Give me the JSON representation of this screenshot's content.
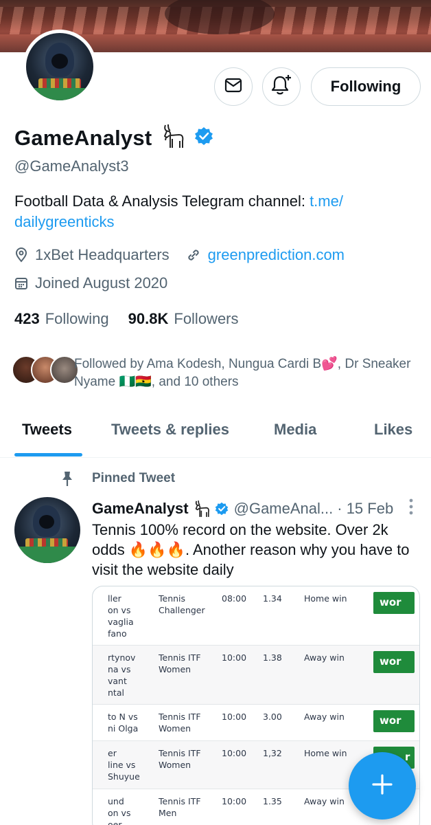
{
  "profile": {
    "name": "GameAnalyst",
    "handle": "@GameAnalyst3",
    "bio_text": "Football Data & Analysis Telegram channel: ",
    "bio_link_1": "t.me/",
    "bio_link_2": "dailygreenticks",
    "location": "1xBet Headquarters",
    "website": "greenprediction.com",
    "joined": "Joined August 2020",
    "following_count": "423",
    "following_label": "Following",
    "followers_count": "90.8K",
    "followers_label": "Followers",
    "follow_button": "Following",
    "followed_by": "Followed by Ama Kodesh, Nungua Cardi B💕, Dr Sneaker Nyame 🇳🇬🇬🇭, and 10 others",
    "verified_color": "#1d9bf0"
  },
  "tabs": [
    {
      "label": "Tweets"
    },
    {
      "label": "Tweets & replies"
    },
    {
      "label": "Media"
    },
    {
      "label": "Likes"
    }
  ],
  "tweet": {
    "pinned_label": "Pinned Tweet",
    "name": "GameAnalyst",
    "handle": "@GameAnal...",
    "date": "· 15 Feb",
    "text": "Tennis 100% record on the website. Over 2k odds 🔥🔥🔥. Another reason why you have to visit the website daily"
  },
  "media_table": {
    "rows": [
      {
        "match": "ller\non vs\nvaglia\nfano",
        "league": "Tennis\nChallenger",
        "time": "08:00",
        "odds": "1.34",
        "tip": "Home win",
        "result": "wor"
      },
      {
        "match": "rtynov\nna vs\nvant\nntal",
        "league": "Tennis ITF\nWomen",
        "time": "10:00",
        "odds": "1.38",
        "tip": "Away win",
        "result": "wor"
      },
      {
        "match": "to N vs\nni Olga",
        "league": "Tennis ITF\nWomen",
        "time": "10:00",
        "odds": "3.00",
        "tip": "Away win",
        "result": "wor"
      },
      {
        "match": "er\nline vs\nShuyue",
        "league": "Tennis ITF\nWomen",
        "time": "10:00",
        "odds": "1,32",
        "tip": "Home win",
        "result": "r"
      },
      {
        "match": "und\non vs\noer",
        "league": "Tennis ITF\nMen",
        "time": "10:00",
        "odds": "1.35",
        "tip": "Away win",
        "result": ""
      }
    ]
  },
  "icons": {
    "message": "envelope-icon",
    "notify": "bell-plus-icon",
    "location": "map-pin-icon",
    "link": "link-icon",
    "calendar": "calendar-icon",
    "pin": "pin-icon",
    "fab": "plus-icon"
  }
}
